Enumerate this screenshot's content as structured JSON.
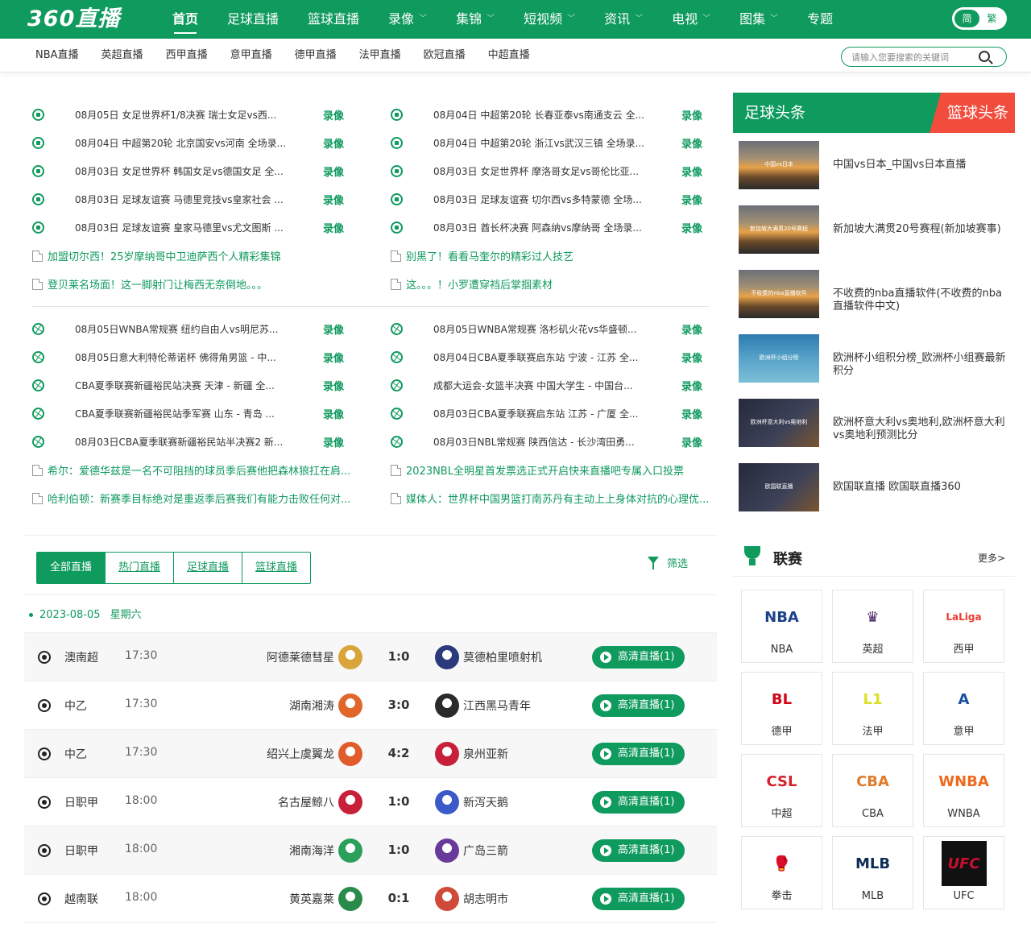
{
  "header": {
    "logo": "360直播",
    "nav": [
      {
        "label": "首页",
        "active": true,
        "dropdown": false
      },
      {
        "label": "足球直播",
        "active": false,
        "dropdown": false
      },
      {
        "label": "篮球直播",
        "active": false,
        "dropdown": false
      },
      {
        "label": "录像",
        "active": false,
        "dropdown": true
      },
      {
        "label": "集锦",
        "active": false,
        "dropdown": true
      },
      {
        "label": "短视频",
        "active": false,
        "dropdown": true
      },
      {
        "label": "资讯",
        "active": false,
        "dropdown": true
      },
      {
        "label": "电视",
        "active": false,
        "dropdown": true
      },
      {
        "label": "图集",
        "active": false,
        "dropdown": true
      },
      {
        "label": "专题",
        "active": false,
        "dropdown": false
      }
    ],
    "lang_simplified": "简",
    "lang_traditional": "繁"
  },
  "subnav": {
    "items": [
      "NBA直播",
      "英超直播",
      "西甲直播",
      "意甲直播",
      "德甲直播",
      "法甲直播",
      "欧冠直播",
      "中超直播"
    ],
    "search_placeholder": "请输入您要搜索的关键词"
  },
  "football_news": {
    "left": [
      {
        "title": "08月05日 女足世界杯1/8决赛 瑞士女足vs西...",
        "tag": "录像"
      },
      {
        "title": "08月04日 中超第20轮 北京国安vs河南 全场录...",
        "tag": "录像"
      },
      {
        "title": "08月03日 女足世界杯 韩国女足vs德国女足 全...",
        "tag": "录像"
      },
      {
        "title": "08月03日 足球友谊赛 马德里竞技vs皇家社会 ...",
        "tag": "录像"
      },
      {
        "title": "08月03日 足球友谊赛 皇家马德里vs尤文图斯 ...",
        "tag": "录像"
      }
    ],
    "right": [
      {
        "title": "08月04日 中超第20轮 长春亚泰vs南通支云 全...",
        "tag": "录像"
      },
      {
        "title": "08月04日 中超第20轮 浙江vs武汉三镇 全场录...",
        "tag": "录像"
      },
      {
        "title": "08月03日 女足世界杯 摩洛哥女足vs哥伦比亚...",
        "tag": "录像"
      },
      {
        "title": "08月03日 足球友谊赛 切尔西vs多特蒙德 全场...",
        "tag": "录像"
      },
      {
        "title": "08月03日 酋长杯决赛 阿森纳vs摩纳哥 全场录...",
        "tag": "录像"
      }
    ],
    "links_left": [
      "加盟切尔西！25岁摩纳哥中卫迪萨西个人精彩集锦",
      "登贝莱名场面！这一脚射门让梅西无奈倒地。。。"
    ],
    "links_right": [
      "别黑了！看看马奎尔的精彩过人技艺",
      "这。。。！小罗遭穿裆后掌掴素材"
    ]
  },
  "basketball_news": {
    "left": [
      {
        "title": "08月05日WNBA常规赛 纽约自由人vs明尼苏...",
        "tag": "录像"
      },
      {
        "title": "08月05日意大利特伦蒂诺杯 佛得角男篮 - 中...",
        "tag": "录像"
      },
      {
        "title": "CBA夏季联赛新疆裕民站决赛 天津 - 新疆 全...",
        "tag": "录像"
      },
      {
        "title": "CBA夏季联赛新疆裕民站季军赛 山东 - 青岛 ...",
        "tag": "录像"
      },
      {
        "title": "08月03日CBA夏季联赛新疆裕民站半决赛2 新...",
        "tag": "录像"
      }
    ],
    "right": [
      {
        "title": "08月05日WNBA常规赛 洛杉矶火花vs华盛顿...",
        "tag": "录像"
      },
      {
        "title": "08月04日CBA夏季联赛启东站 宁波 - 江苏 全...",
        "tag": "录像"
      },
      {
        "title": "成都大运会-女篮半决赛 中国大学生 - 中国台...",
        "tag": "录像"
      },
      {
        "title": "08月03日CBA夏季联赛启东站 江苏 - 广厦 全...",
        "tag": "录像"
      },
      {
        "title": "08月03日NBL常规赛 陕西信达 - 长沙湾田勇...",
        "tag": "录像"
      }
    ],
    "links_left": [
      "希尔：爱德华兹是一名不可阻挡的球员季后赛他把森林狼扛在肩...",
      "哈利伯顿：新赛季目标绝对是重返季后赛我们有能力击败任何对..."
    ],
    "links_right": [
      "2023NBL全明星首发票选正式开启快来直播吧专属入口投票",
      "媒体人：世界杯中国男篮打南苏丹有主动上上身体对抗的心理优..."
    ]
  },
  "tabs": {
    "items": [
      {
        "label": "全部直播",
        "active": true
      },
      {
        "label": "热门直播",
        "active": false
      },
      {
        "label": "足球直播",
        "active": false
      },
      {
        "label": "篮球直播",
        "active": false
      }
    ],
    "filter_label": "筛选"
  },
  "schedule": {
    "date": "2023-08-05",
    "weekday": "星期六",
    "live_label": "高清直播(1)",
    "matches": [
      {
        "league": "澳南超",
        "time": "17:30",
        "home": "阿德莱德彗星",
        "score": "1:0",
        "away": "莫德柏里喷射机",
        "home_color": "#d9a43a",
        "away_color": "#2a3a7a"
      },
      {
        "league": "中乙",
        "time": "17:30",
        "home": "湖南湘涛",
        "score": "3:0",
        "away": "江西黑马青年",
        "home_color": "#e0662a",
        "away_color": "#2a2a2a"
      },
      {
        "league": "中乙",
        "time": "17:30",
        "home": "绍兴上虞翼龙",
        "score": "4:2",
        "away": "泉州亚新",
        "home_color": "#e05c2a",
        "away_color": "#c8203a"
      },
      {
        "league": "日职甲",
        "time": "18:00",
        "home": "名古屋鲸八",
        "score": "1:0",
        "away": "新泻天鹅",
        "home_color": "#c8203a",
        "away_color": "#3a5ac8"
      },
      {
        "league": "日职甲",
        "time": "18:00",
        "home": "湘南海洋",
        "score": "1:0",
        "away": "广岛三箭",
        "home_color": "#2aa05c",
        "away_color": "#6a3a9a"
      },
      {
        "league": "越南联",
        "time": "18:00",
        "home": "黄英嘉莱",
        "score": "0:1",
        "away": "胡志明市",
        "home_color": "#2a8a4a",
        "away_color": "#d04a3a"
      }
    ]
  },
  "headlines": {
    "tab_football": "足球头条",
    "tab_basketball": "篮球头条",
    "items": [
      {
        "thumb_text": "中国vs日本",
        "style": "sunset",
        "title": "中国vs日本_中国vs日本直播"
      },
      {
        "thumb_text": "新加坡大满贯20号赛程",
        "style": "sunset",
        "title": "新加坡大满贯20号赛程(新加坡赛事)"
      },
      {
        "thumb_text": "不收费的nba直播软件",
        "style": "sunset",
        "title": "不收费的nba直播软件(不收费的nba直播软件中文)"
      },
      {
        "thumb_text": "欧洲杯小组分榜",
        "style": "wheel",
        "title": "欧洲杯小组积分榜_欧洲杯小组赛最新积分"
      },
      {
        "thumb_text": "欧洲杯意大利vs奥地利",
        "style": "fire",
        "title": "欧洲杯意大利vs奥地利,欧洲杯意大利vs奥地利预测比分"
      },
      {
        "thumb_text": "欧国联直播",
        "style": "fire",
        "title": "欧国联直播 欧国联直播360"
      }
    ]
  },
  "leagues": {
    "title": "联赛",
    "more": "更多>",
    "items": [
      {
        "name": "NBA",
        "mark": "NBA",
        "color": "#1d428a"
      },
      {
        "name": "英超",
        "mark": "♛",
        "color": "#3d195b"
      },
      {
        "name": "西甲",
        "mark": "LaLiga",
        "color": "#ee3b2f"
      },
      {
        "name": "德甲",
        "mark": "BL",
        "color": "#d20515"
      },
      {
        "name": "法甲",
        "mark": "L1",
        "color": "#dae025"
      },
      {
        "name": "意甲",
        "mark": "A",
        "color": "#1b4fa0"
      },
      {
        "name": "中超",
        "mark": "CSL",
        "color": "#d61f2b"
      },
      {
        "name": "CBA",
        "mark": "CBA",
        "color": "#e07b2a"
      },
      {
        "name": "WNBA",
        "mark": "WNBA",
        "color": "#ee6a1f"
      },
      {
        "name": "拳击",
        "mark": "🥊",
        "color": "#222222"
      },
      {
        "name": "MLB",
        "mark": "MLB",
        "color": "#0c2c56"
      },
      {
        "name": "UFC",
        "mark": "UFC",
        "color": "#c8102e"
      }
    ]
  }
}
